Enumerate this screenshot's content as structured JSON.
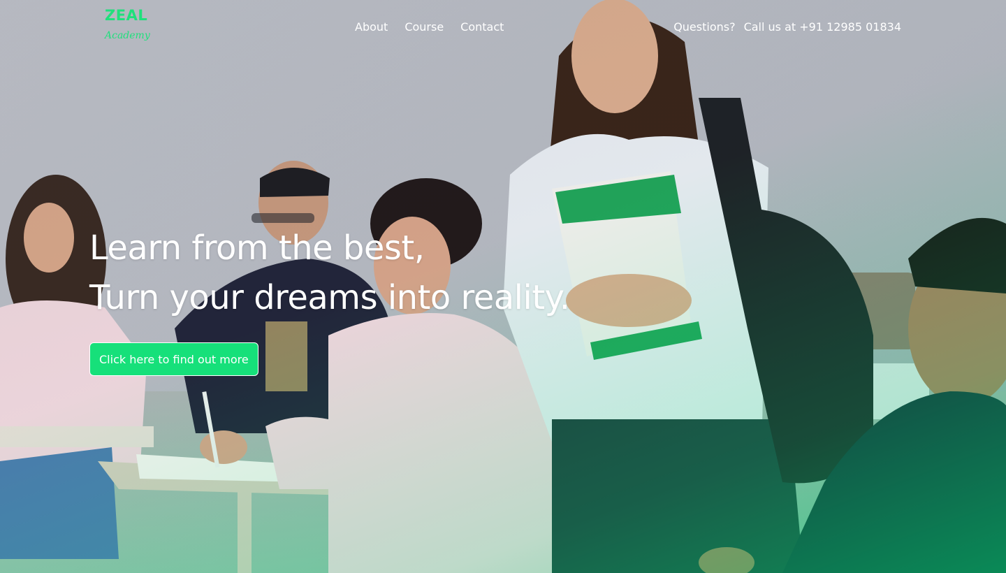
{
  "brand": {
    "name": "ZEAL",
    "subtitle": "Academy",
    "color": "#1fe07c"
  },
  "nav": {
    "items": [
      {
        "label": "About"
      },
      {
        "label": "Course"
      },
      {
        "label": "Contact"
      }
    ]
  },
  "contact": {
    "question": "Questions?",
    "phone": "Call us at +91 12985 01834"
  },
  "hero": {
    "line1": "Learn from the best,",
    "line2": "Turn your dreams into reality.",
    "cta_label": "Click here to find out more",
    "accent": "#16e07a"
  }
}
